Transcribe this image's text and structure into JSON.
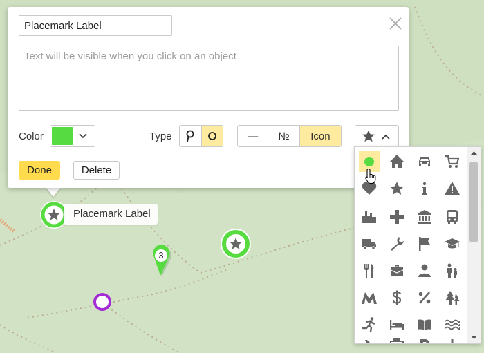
{
  "editor": {
    "title_value": "Placemark Label",
    "description_placeholder": "Text will be visible when you click on an object",
    "color_label": "Color",
    "selected_color": "#56db40",
    "type_label": "Type",
    "type_options": [
      "pin-icon",
      "circle-icon"
    ],
    "type_selected": "circle-icon",
    "style_options": [
      "—",
      "№",
      "Icon"
    ],
    "style_selected": "Icon",
    "done_label": "Done",
    "delete_label": "Delete"
  },
  "map": {
    "placemark_label": "Placemark Label",
    "cluster_count": "3",
    "accent_green": "#56db40",
    "accent_purple": "#a32cd6"
  },
  "icon_panel": {
    "selected_icon": "dot-icon",
    "icons": [
      "dot-icon",
      "home-icon",
      "car-icon",
      "cart-icon",
      "heart-icon",
      "star-icon",
      "info-icon",
      "warning-icon",
      "factory-icon",
      "cross-icon",
      "bank-icon",
      "bus-icon",
      "truck-icon",
      "wrench-icon",
      "flag-icon",
      "graduation-cap-icon",
      "fork-knife-icon",
      "briefcase-icon",
      "person-icon",
      "family-icon",
      "mountain-icon",
      "dollar-icon",
      "percent-icon",
      "trees-icon",
      "running-icon",
      "bed-icon",
      "book-icon",
      "waves-icon",
      "airplane-icon",
      "suitcase-icon",
      "parking-icon",
      "plus-icon"
    ]
  }
}
